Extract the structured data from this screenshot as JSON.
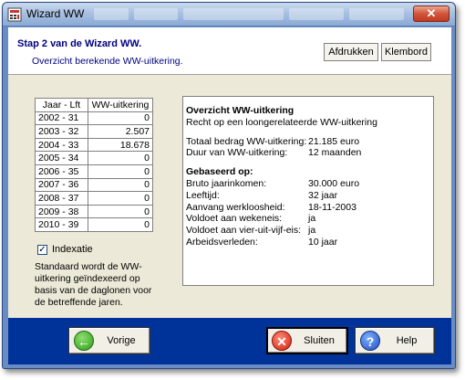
{
  "window": {
    "title": "Wizard WW",
    "close_glyph": "✕",
    "app_icon": "calculator-icon"
  },
  "header": {
    "step_title": "Stap 2 van de Wizard WW.",
    "step_subtitle": "Overzicht berekende WW-uitkering.",
    "print_label": "Afdrukken",
    "clipboard_label": "Klembord"
  },
  "year_table": {
    "columns": [
      "Jaar - Lft",
      "WW-uitkering"
    ],
    "rows": [
      {
        "year": "2002 - 31",
        "amount": "0"
      },
      {
        "year": "2003 - 32",
        "amount": "2.507"
      },
      {
        "year": "2004 - 33",
        "amount": "18.678"
      },
      {
        "year": "2005 - 34",
        "amount": "0"
      },
      {
        "year": "2006 - 35",
        "amount": "0"
      },
      {
        "year": "2007 - 36",
        "amount": "0"
      },
      {
        "year": "2008 - 37",
        "amount": "0"
      },
      {
        "year": "2009 - 38",
        "amount": "0"
      },
      {
        "year": "2010 - 39",
        "amount": "0"
      }
    ]
  },
  "indexation": {
    "label": "Indexatie",
    "checked": true,
    "check_glyph": "✓",
    "description": "Standaard wordt de WW-uitkering geïndexeerd op basis van de daglonen voor de betreffende jaren."
  },
  "summary": {
    "title": "Overzicht WW-uitkering",
    "subtitle": "Recht op een loongerelateerde WW-uitkering",
    "totals": [
      {
        "label": "Totaal bedrag WW-uitkering:",
        "value": "21.185 euro"
      },
      {
        "label": "Duur van WW-uitkering:",
        "value": "12 maanden"
      }
    ],
    "based_title": "Gebaseerd op:",
    "based": [
      {
        "label": "Bruto jaarinkomen:",
        "value": "30.000 euro"
      },
      {
        "label": "Leeftijd:",
        "value": "32 jaar"
      },
      {
        "label": "Aanvang werkloosheid:",
        "value": "18-11-2003"
      },
      {
        "label": "Voldoet aan wekeneis:",
        "value": "ja"
      },
      {
        "label": "Voldoet aan vier-uit-vijf-eis:",
        "value": "ja"
      },
      {
        "label": "Arbeidsverleden:",
        "value": "10 jaar"
      }
    ]
  },
  "footer": {
    "back_label": "Vorige",
    "close_label": "Sluiten",
    "help_label": "Help",
    "back_icon": "arrow-left-icon",
    "close_icon": "close-circle-icon",
    "help_icon": "help-icon",
    "back_glyph": "←",
    "close_glyph": "✕",
    "help_glyph": "?"
  },
  "colors": {
    "footer_bg": "#003399",
    "header_text": "#000080",
    "title_bar": "#a9c1e1",
    "client_bg": "#ece9d8"
  }
}
